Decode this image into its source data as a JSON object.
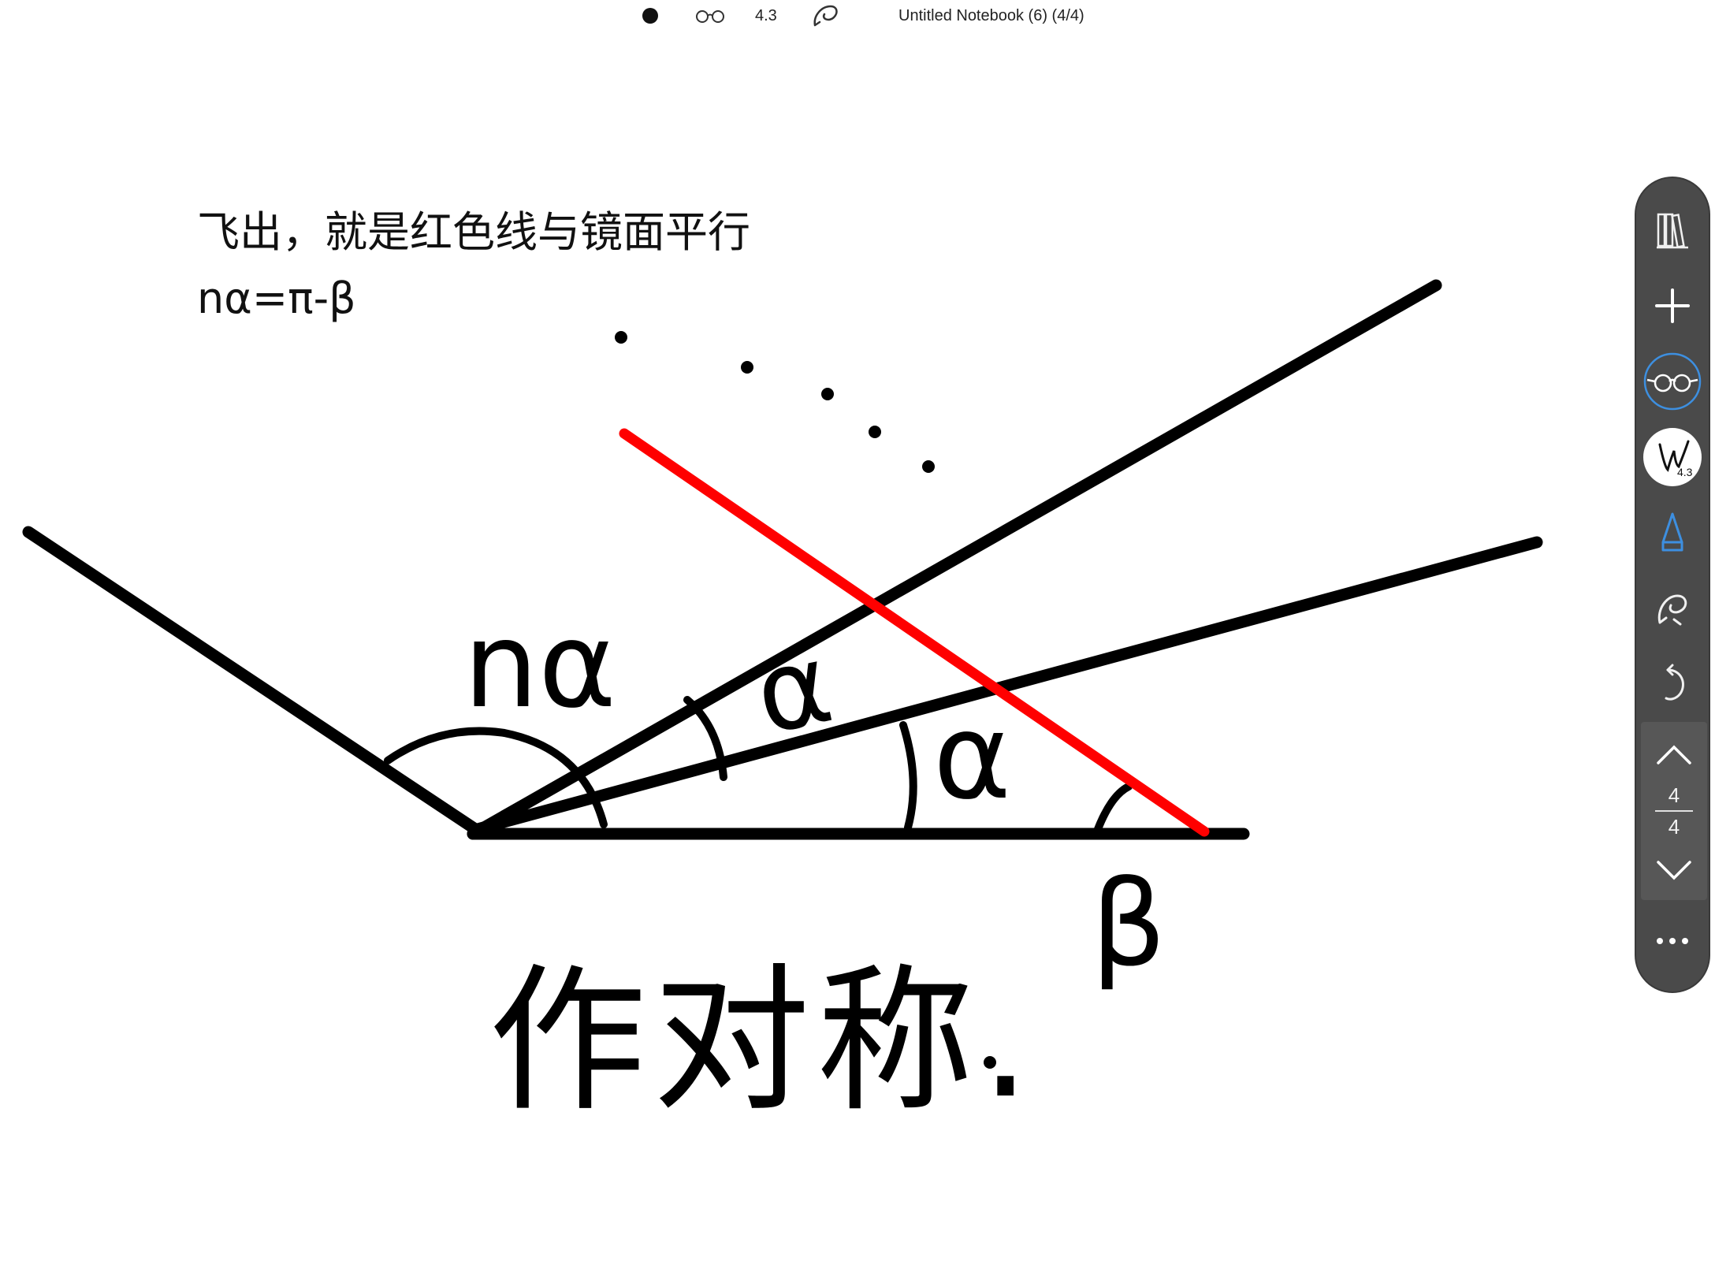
{
  "app": {
    "title": "Untitled Notebook (6) (4/4)",
    "pen_size": "4.3"
  },
  "notes": {
    "line1": "飞出，就是红色线与镜面平行",
    "line2": "nα=π-β"
  },
  "handwriting": {
    "label_n_alpha": "nα",
    "label_alpha_1": "α",
    "label_alpha_2": "α",
    "label_beta": "β",
    "bottom_text": "作对称."
  },
  "toolbar": {
    "pen_size": "4.3",
    "page_current": "4",
    "page_total": "4"
  },
  "icons": {
    "top": [
      "record-dot-icon",
      "glasses-icon",
      "lasso-icon"
    ],
    "side": [
      "library-icon",
      "add-icon",
      "reading-mode-icon",
      "pen-icon",
      "highlighter-icon",
      "lasso-icon",
      "undo-icon",
      "chevron-up-icon",
      "chevron-down-icon",
      "more-icon"
    ]
  },
  "colors": {
    "ink": "#000000",
    "red_line": "#ff0000",
    "toolbar_bg": "#4a4a4a",
    "accent_blue": "#3d8fe0"
  }
}
